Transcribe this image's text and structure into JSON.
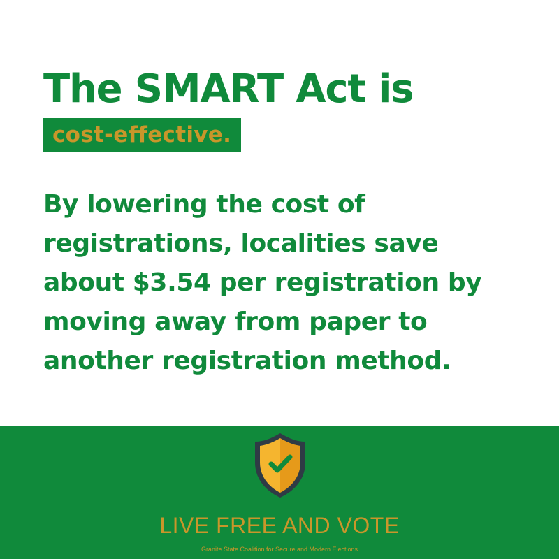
{
  "headline": "The SMART Act is",
  "highlight": "cost-effective.",
  "body_lines": [
    "By lowering the cost of",
    "registrations, localities save",
    "about $3.54 per registration by",
    "moving away from paper to",
    "another registration method."
  ],
  "footer": {
    "org_name": "LIVE FREE AND VOTE",
    "tagline": "Granite State Coalition for Secure and Modern Elections",
    "logo_icon": "shield-check-icon"
  },
  "colors": {
    "page_background": "#ffffff",
    "brand_green": "#108a3b",
    "gold": "#c9962a",
    "shield_light": "#f5b52f",
    "shield_dark": "#e69a1a",
    "shield_outline": "#2f3b45",
    "check": "#108a3b"
  }
}
